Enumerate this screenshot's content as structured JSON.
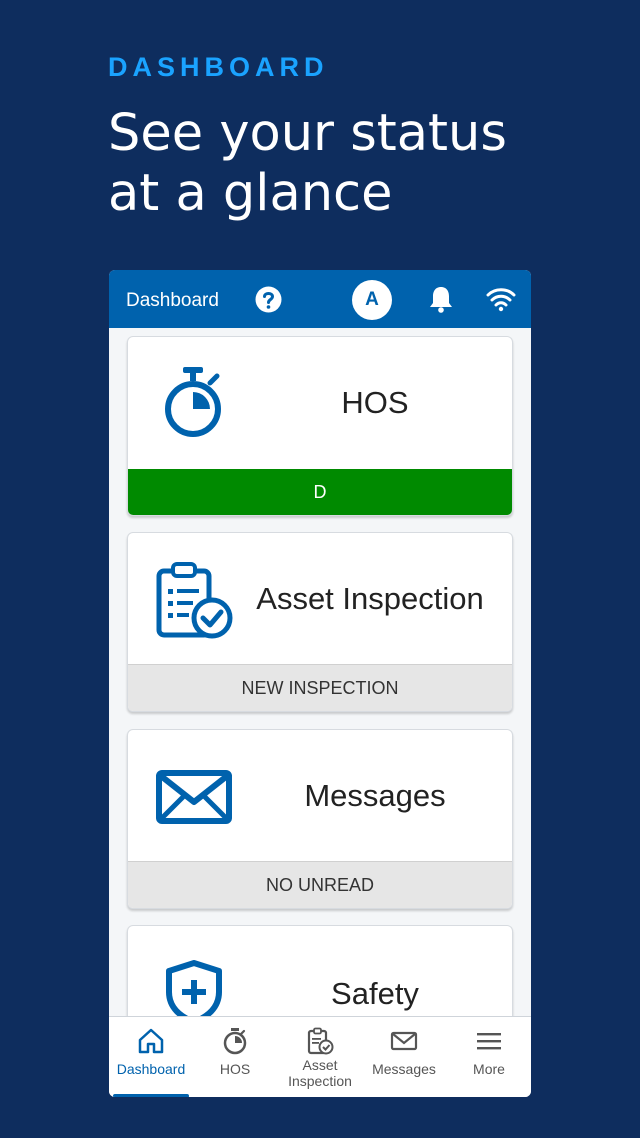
{
  "hero": {
    "eyebrow": "DASHBOARD",
    "headline": "See your status at a glance"
  },
  "appbar": {
    "title": "Dashboard",
    "avatar_initial": "A",
    "color": "#0062ad"
  },
  "cards": [
    {
      "title": "HOS",
      "footer": "D",
      "icon": "stopwatch-icon",
      "footer_color": "#008a00"
    },
    {
      "title": "Asset Inspection",
      "footer": "NEW INSPECTION",
      "icon": "clipboard-check-icon"
    },
    {
      "title": "Messages",
      "footer": "NO UNREAD",
      "icon": "envelope-icon"
    },
    {
      "title": "Safety",
      "icon": "shield-plus-icon"
    }
  ],
  "nav": {
    "items": [
      {
        "label": "Dashboard",
        "icon": "home-icon",
        "active": true
      },
      {
        "label": "HOS",
        "icon": "stopwatch-icon"
      },
      {
        "label": "Asset Inspection",
        "icon": "clipboard-check-icon"
      },
      {
        "label": "Messages",
        "icon": "envelope-icon"
      },
      {
        "label": "More",
        "icon": "hamburger-icon"
      }
    ]
  },
  "colors": {
    "background": "#0e2d5e",
    "accent": "#1aa3ff",
    "brand": "#0062ad",
    "status_green": "#008a00"
  }
}
